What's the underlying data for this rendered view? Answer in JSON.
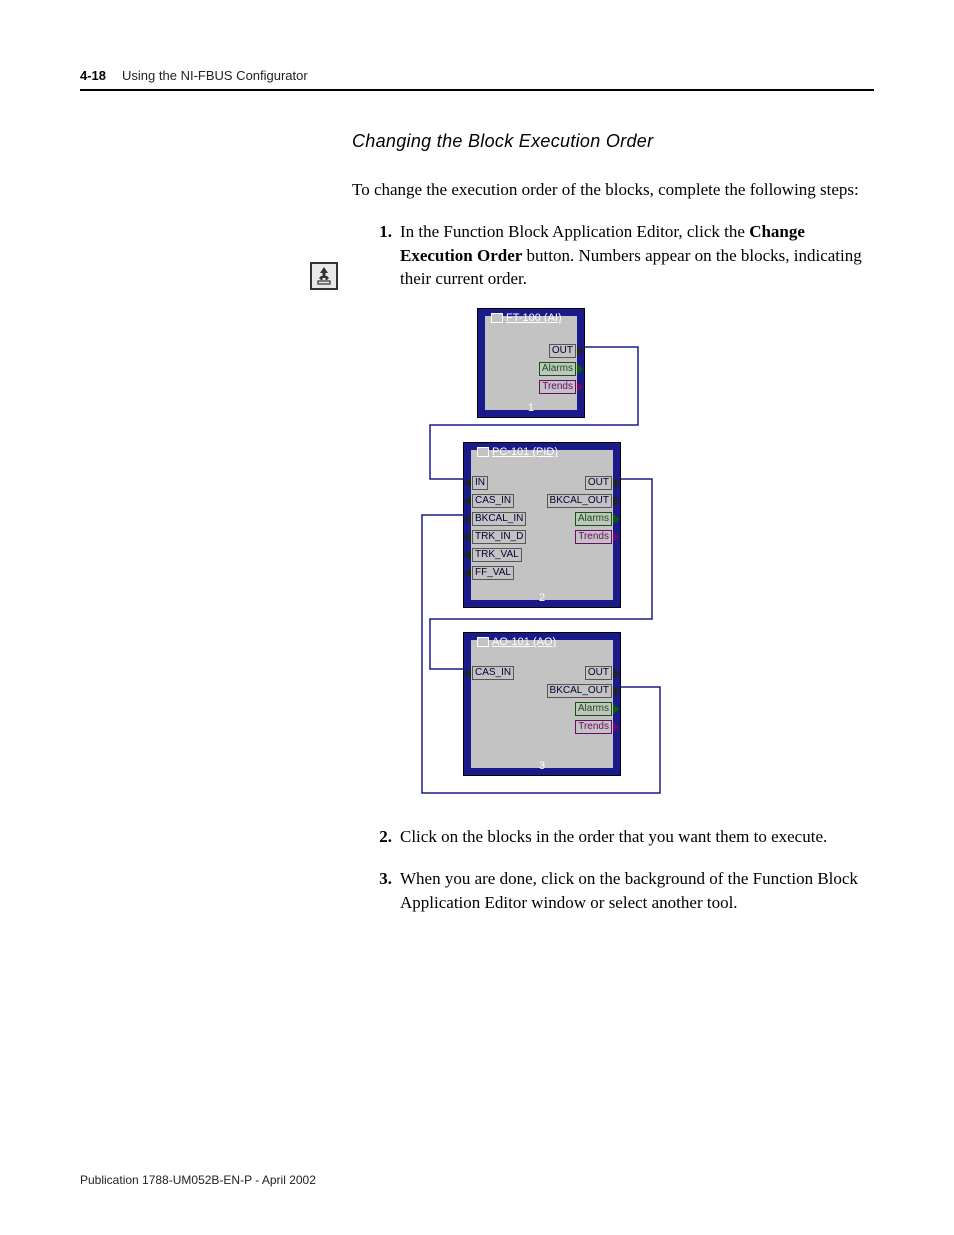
{
  "header": {
    "page": "4-18",
    "chapter": "Using the NI-FBUS Configurator"
  },
  "subheading": "Changing the Block Execution Order",
  "intro": "To change the execution order of the blocks, complete the following steps:",
  "steps": {
    "s1_a": "In the Function Block Application Editor, click the ",
    "s1_b": "Change Execution Order",
    "s1_c": " button. Numbers appear on the blocks, indicating their current order.",
    "s2": "Click on the blocks in the order that you want them to execute.",
    "s3": "When you are done, click on the background of the Function Block Application Editor window or select another tool."
  },
  "diagram": {
    "b1": {
      "title": "FT-100 (AI)",
      "order": "1",
      "out": "OUT",
      "alarms": "Alarms",
      "trends": "Trends"
    },
    "b2": {
      "title": "PC-101 (PID)",
      "order": "2",
      "in": "IN",
      "cas_in": "CAS_IN",
      "bkcal_in": "BKCAL_IN",
      "trk_in_d": "TRK_IN_D",
      "trk_val": "TRK_VAL",
      "ff_val": "FF_VAL",
      "out": "OUT",
      "bkcal_out": "BKCAL_OUT",
      "alarms": "Alarms",
      "trends": "Trends"
    },
    "b3": {
      "title": "AO-101 (AO)",
      "order": "3",
      "cas_in": "CAS_IN",
      "out": "OUT",
      "bkcal_out": "BKCAL_OUT",
      "alarms": "Alarms",
      "trends": "Trends"
    }
  },
  "footer": "Publication 1788-UM052B-EN-P - April 2002",
  "icon": "change-execution-order-icon"
}
